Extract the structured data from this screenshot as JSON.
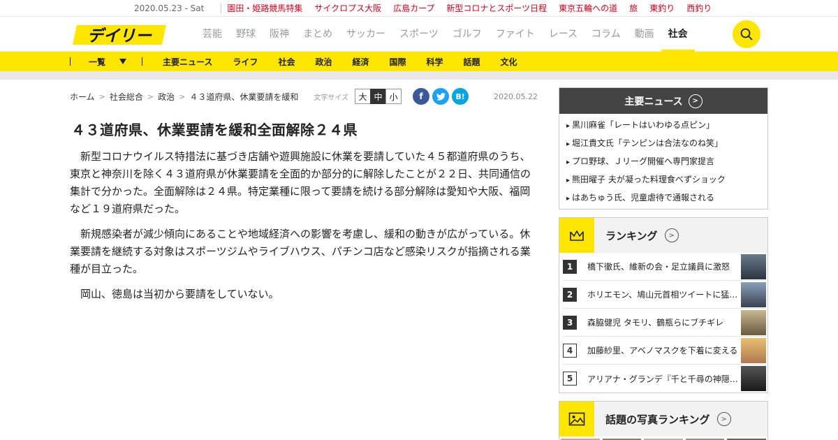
{
  "topbar": {
    "date": "2020.05.23 - Sat",
    "links": [
      "園田・姫路競馬特集",
      "サイクロプス大阪",
      "広島カープ",
      "新型コロナとスポーツ日程",
      "東京五輪への道",
      "旅",
      "東釣り",
      "西釣り"
    ]
  },
  "header": {
    "logo_text": "デイリー",
    "nav": [
      "芸能",
      "野球",
      "阪神",
      "まとめ",
      "サッカー",
      "スポーツ",
      "ゴルフ",
      "ファイト",
      "レース",
      "コラム",
      "動画",
      "社会"
    ],
    "active_nav": "社会"
  },
  "subnav": {
    "all_label": "一覧",
    "items": [
      "主要ニュース",
      "ライフ",
      "社会",
      "政治",
      "経済",
      "国際",
      "科学",
      "話題",
      "文化"
    ]
  },
  "breadcrumb": [
    "ホーム",
    "社会総合",
    "政治",
    "４３道府県、休業要請を緩和"
  ],
  "font_size": {
    "label": "文字サイズ",
    "options": [
      "大",
      "中",
      "小"
    ],
    "selected": "中"
  },
  "share": {
    "facebook": "f",
    "twitter": "t",
    "hatena": "B!"
  },
  "article": {
    "date": "2020.05.22",
    "title": "４３道府県、休業要請を緩和全面解除２４県",
    "paragraphs": [
      "新型コロナウイルス特措法に基づき店舗や遊興施設に休業を要請していた４５都道府県のうち、東京と神奈川を除く４３道府県が休業要請を全面的か部分的に解除したことが２２日、共同通信の集計で分かった。全面解除は２４県。特定業種に限って要請を続ける部分解除は愛知や大阪、福岡など１９道府県だった。",
      "新規感染者が減少傾向にあることや地域経済への影響を考慮し、緩和の動きが広がっている。休業要請を継続する対象はスポーツジムやライブハウス、パチンコ店など感染リスクが指摘される業種が目立った。",
      "岡山、徳島は当初から要請をしていない。"
    ]
  },
  "sidebar": {
    "news": {
      "title": "主要ニュース",
      "items": [
        "黒川麻雀「レートはいわゆる点ピン」",
        "堀江貴文氏「テンピンは合法なのね笑」",
        "プロ野球、Ｊリーグ開催へ専門家提言",
        "熊田曜子 夫が凝った料理食べずショック",
        "はあちゅう氏、児童虐待で通報される"
      ]
    },
    "ranking": {
      "title": "ランキング",
      "items": [
        {
          "rank": "1",
          "text": "橋下徹氏、維新の会・足立議員に激怒"
        },
        {
          "rank": "2",
          "text": "ホリエモン、鳩山元首相ツイートに猛反論"
        },
        {
          "rank": "3",
          "text": "森脇健児 タモリ、鶴瓶らにブチギレ"
        },
        {
          "rank": "4",
          "text": "加藤紗里、アベノマスクを下着に変える"
        },
        {
          "rank": "5",
          "text": "アリアナ・グランデ『千と千尋の神隠し』"
        }
      ]
    },
    "photo_ranking": {
      "title": "話題の写真ランキング"
    }
  },
  "colors": {
    "brand_yellow": "#ffe600",
    "link_red": "#d0021b",
    "facebook": "#3b5998",
    "twitter": "#1da1f2",
    "hatena": "#00a4de"
  }
}
